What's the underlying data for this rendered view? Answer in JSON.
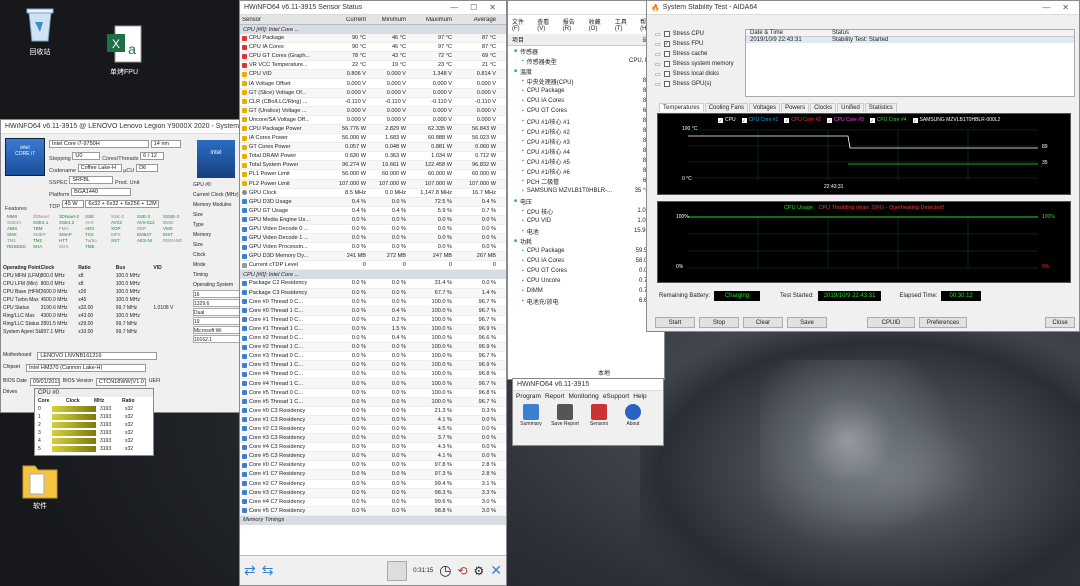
{
  "desktop": {
    "icons": [
      {
        "label": "回收站"
      },
      {
        "label": "单烤FPU"
      },
      {
        "label": "软件"
      }
    ]
  },
  "hw_sensors": {
    "title": "HWiNFO64 v6.11-3915 Sensor Status",
    "headers": [
      "Sensor",
      "Current",
      "Minimum",
      "Maximum",
      "Average"
    ],
    "groups": [
      {
        "name": "CPU [#0]: Intel Core ...",
        "rows": [
          [
            "CPU Package",
            "90 °C",
            "46 °C",
            "97 °C",
            "87 °C"
          ],
          [
            "CPU IA Cores",
            "90 °C",
            "46 °C",
            "97 °C",
            "87 °C"
          ],
          [
            "CPU GT Cores (Graph...",
            "78 °C",
            "43 °C",
            "72 °C",
            "69 °C"
          ],
          [
            "VR VCC Temperature...",
            "22 °C",
            "19 °C",
            "23 °C",
            "21 °C"
          ],
          [
            "CPU VID",
            "0.806 V",
            "0.000 V",
            "1.348 V",
            "0.814 V"
          ],
          [
            "IA Voltage Offset",
            "0.000 V",
            "0.000 V",
            "0.000 V",
            "0.000 V"
          ],
          [
            "GT (Slice) Voltage Of...",
            "0.000 V",
            "0.000 V",
            "0.000 V",
            "0.000 V"
          ],
          [
            "CLR (CBo/LLC/Ring) ...",
            "-0.110 V",
            "-0.110 V",
            "-0.110 V",
            "-0.110 V"
          ],
          [
            "GT (Unslice) Voltage ...",
            "0.000 V",
            "0.000 V",
            "0.000 V",
            "0.000 V"
          ],
          [
            "Uncore/SA Voltage Off...",
            "0.000 V",
            "0.000 V",
            "0.000 V",
            "0.000 V"
          ],
          [
            "CPU Package Power",
            "56.776 W",
            "2.829 W",
            "62.335 W",
            "56.843 W"
          ],
          [
            "IA Cores Power",
            "56.000 W",
            "1.683 W",
            "60.888 W",
            "56.023 W"
          ],
          [
            "GT Cores Power",
            "0.057 W",
            "0.048 W",
            "0.881 W",
            "0.060 W"
          ],
          [
            "Total DRAM Power",
            "0.630 W",
            "0.363 W",
            "1.034 W",
            "0.712 W"
          ],
          [
            "Total System Power",
            "96.274 W",
            "19.661 W",
            "122.458 W",
            "96.832 W"
          ],
          [
            "PL1 Power Limit",
            "56.000 W",
            "60.000 W",
            "60.000 W",
            "60.000 W"
          ],
          [
            "PL2 Power Limit",
            "107.000 W",
            "107.000 W",
            "107.000 W",
            "107.000 W"
          ],
          [
            "GPU Clock",
            "8.5 MHz",
            "0.0 MHz",
            "1,147.8 MHz",
            "16.7 MHz"
          ],
          [
            "GPU D3D Usage",
            "0.4 %",
            "0.0 %",
            "72.5 %",
            "0.4 %"
          ],
          [
            "GPU GT Usage",
            "0.4 %",
            "0.4 %",
            "5.9 %",
            "0.7 %"
          ],
          [
            "GPU Media Engine Us...",
            "0.0 %",
            "0.0 %",
            "0.0 %",
            "0.0 %"
          ],
          [
            "GPU Video Decode 0 ...",
            "0.0 %",
            "0.0 %",
            "0.0 %",
            "0.0 %"
          ],
          [
            "GPU Video Decode 1 ...",
            "0.0 %",
            "0.0 %",
            "0.0 %",
            "0.0 %"
          ],
          [
            "GPU Video Processin...",
            "0.0 %",
            "0.0 %",
            "0.0 %",
            "0.0 %"
          ],
          [
            "GPU D3D Memory Dy...",
            "241 MB",
            "272 MB",
            "247 MB",
            "267 MB"
          ],
          [
            "Current cTDP Level",
            "0",
            "0",
            "0",
            "0"
          ]
        ]
      },
      {
        "name": "CPU [#0]: Intel Core ...",
        "rows": [
          [
            "Package C2 Residency",
            "0.0 %",
            "0.0 %",
            "31.4 %",
            "0.0 %"
          ],
          [
            "Package C3 Residency",
            "0.0 %",
            "0.0 %",
            "67.7 %",
            "1.4 %"
          ],
          [
            "Core #0 Thread 0 C...",
            "0.0 %",
            "0.0 %",
            "100.0 %",
            "96.7 %"
          ],
          [
            "Core #0 Thread 1 C...",
            "0.0 %",
            "0.4 %",
            "100.0 %",
            "96.7 %"
          ],
          [
            "Core #1 Thread 0 C...",
            "0.0 %",
            "0.2 %",
            "100.0 %",
            "96.7 %"
          ],
          [
            "Core #1 Thread 1 C...",
            "0.0 %",
            "1.5 %",
            "100.0 %",
            "96.9 %"
          ],
          [
            "Core #2 Thread 0 C...",
            "0.0 %",
            "0.4 %",
            "100.0 %",
            "96.6 %"
          ],
          [
            "Core #2 Thread 1 C...",
            "0.0 %",
            "0.0 %",
            "100.0 %",
            "96.9 %"
          ],
          [
            "Core #3 Thread 0 C...",
            "0.0 %",
            "0.0 %",
            "100.0 %",
            "96.7 %"
          ],
          [
            "Core #3 Thread 1 C...",
            "0.0 %",
            "0.0 %",
            "100.0 %",
            "96.9 %"
          ],
          [
            "Core #4 Thread 0 C...",
            "0.0 %",
            "0.0 %",
            "100.0 %",
            "96.8 %"
          ],
          [
            "Core #4 Thread 1 C...",
            "0.0 %",
            "0.0 %",
            "100.0 %",
            "96.7 %"
          ],
          [
            "Core #5 Thread 0 C...",
            "0.0 %",
            "0.0 %",
            "100.0 %",
            "96.8 %"
          ],
          [
            "Core #5 Thread 1 C...",
            "0.0 %",
            "0.0 %",
            "100.0 %",
            "96.7 %"
          ],
          [
            "Core #0 C3 Residency",
            "0.0 %",
            "0.0 %",
            "21.3 %",
            "0.3 %"
          ],
          [
            "Core #1 C3 Residency",
            "0.0 %",
            "0.0 %",
            "4.1 %",
            "0.0 %"
          ],
          [
            "Core #2 C3 Residency",
            "0.0 %",
            "0.0 %",
            "4.5 %",
            "0.0 %"
          ],
          [
            "Core #3 C3 Residency",
            "0.0 %",
            "0.0 %",
            "3.7 %",
            "0.0 %"
          ],
          [
            "Core #4 C3 Residency",
            "0.0 %",
            "0.0 %",
            "4.3 %",
            "0.0 %"
          ],
          [
            "Core #5 C3 Residency",
            "0.0 %",
            "0.0 %",
            "4.1 %",
            "0.0 %"
          ],
          [
            "Core #0 C7 Residency",
            "0.0 %",
            "0.0 %",
            "97.8 %",
            "2.8 %"
          ],
          [
            "Core #1 C7 Residency",
            "0.0 %",
            "0.0 %",
            "97.3 %",
            "2.8 %"
          ],
          [
            "Core #2 C7 Residency",
            "0.0 %",
            "0.0 %",
            "99.4 %",
            "3.1 %"
          ],
          [
            "Core #3 C7 Residency",
            "0.0 %",
            "0.0 %",
            "98.3 %",
            "3.3 %"
          ],
          [
            "Core #4 C7 Residency",
            "0.0 %",
            "0.0 %",
            "99.6 %",
            "3.0 %"
          ],
          [
            "Core #5 C7 Residency",
            "0.0 %",
            "0.0 %",
            "98.8 %",
            "3.0 %"
          ]
        ]
      }
    ],
    "footer_group": "Memory Timings",
    "timer": "0:31:15"
  },
  "hw_summary": {
    "title": "HWiNFO64 v6.11-3915 @ LENOVO Lenovo Legion Y9000X 2020 - System Summary",
    "cpu_name": "Intel Core i7-9750H",
    "nm": "14 nm",
    "stepping_label": "Stepping",
    "stepping": "U0",
    "cores_label": "Cores/Threads",
    "cores": "6 / 12",
    "codename_label": "Codename",
    "codename": "Coffee Lake-H",
    "ucu_label": "µCU",
    "ucu": "D6",
    "sspec_label": "SSPEC",
    "sspec": "SRFBL",
    "prod_label": "Prod. Unit",
    "platform_label": "Platform",
    "platform": "BGA1440",
    "tdp_label": "TDP",
    "tdp": "45 W",
    "cache": "6x32 + 6x32 + 6x256 + 12M",
    "features_label": "Features",
    "features": [
      "MMX",
      "3DNow!",
      "3DNow!-2",
      "SSE",
      "SSE-2",
      "SSE-3",
      "SSSE-3",
      "SSE4A",
      "SSE4.1",
      "SSE4.2",
      "AVX",
      "AVX2",
      "AVX-512",
      "BMI2",
      "ABM",
      "TBM",
      "FMA",
      "ADX",
      "XOP",
      "DEP",
      "VMX",
      "SMX",
      "SMEP",
      "SMAP",
      "TSX",
      "MPX",
      "EM64T",
      "EIST",
      "TM1",
      "TM2",
      "HTT",
      "Turbo",
      "SST",
      "AES-NI",
      "RDRAND",
      "RDSEED",
      "SHA",
      "SGX",
      "TME"
    ],
    "op_headers": [
      "Operating Point",
      "Clock",
      "Ratio",
      "Bus",
      "VID"
    ],
    "op_rows": [
      [
        "CPU MFM (LFM)",
        "800.0 MHz",
        "x8",
        "100.0 MHz",
        ""
      ],
      [
        "CPU LFM (Min)",
        "800.0 MHz",
        "x8",
        "100.0 MHz",
        ""
      ],
      [
        "CPU Base (HFM)",
        "2600.0 MHz",
        "x26",
        "100.0 MHz",
        ""
      ],
      [
        "CPU Turbo Max",
        "4500.0 MHz",
        "x45",
        "100.0 MHz",
        ""
      ],
      [
        "CPU Status",
        "3190.6 MHz",
        "x32.00",
        "99.7 MHz",
        "1.0108 V"
      ],
      [
        "Ring/LLC Max",
        "4300.0 MHz",
        "x43.00",
        "100.0 MHz",
        ""
      ],
      [
        "Ring/LLC Status",
        "2891.5 MHz",
        "x29.00",
        "99.7 MHz",
        ""
      ],
      [
        "System Agent Status",
        "997.1 MHz",
        "x10.00",
        "99.7 MHz",
        ""
      ]
    ],
    "mb_label": "Motherboard",
    "mb": "LENOVO LNVNB161216",
    "chipset_label": "Chipset",
    "chipset": "Intel HM370 (Cannon Lake-H)",
    "bios_label": "BIOS Date",
    "bios_date": "09/01/2019",
    "bios_ver_label": "BIOS Version",
    "bios_ver": "CTCN18WW(V1.07)",
    "uefi": "UEFI",
    "drives_label": "Drives",
    "gpu_label": "GPU #0",
    "right_labels": [
      "Current Clock (MHz)",
      "Memory Modules",
      "Size",
      "Type",
      "Memory",
      "Size",
      "Clock",
      "Mode",
      "Timing",
      "Operating System"
    ],
    "right_vals": [
      "16",
      "1329.6",
      "Dual",
      "19",
      "Microsoft Wi",
      "10162.1"
    ]
  },
  "cpu_clocks": {
    "title": "CPU #0",
    "headers": [
      "Core",
      "Clock",
      "MHz",
      "Ratio"
    ],
    "rows": [
      [
        "0",
        "",
        "3193",
        "x32"
      ],
      [
        "1",
        "",
        "3193",
        "x32"
      ],
      [
        "2",
        "",
        "3193",
        "x32"
      ],
      [
        "3",
        "",
        "3193",
        "x32"
      ],
      [
        "4",
        "",
        "3193",
        "x32"
      ],
      [
        "5",
        "",
        "3193",
        "x32"
      ]
    ]
  },
  "aida_tree": {
    "menu": [
      "文件(F)",
      "查看(V)",
      "报告(R)",
      "收藏(O)",
      "工具(T)",
      "帮助(H)"
    ],
    "col_left": "项目",
    "col_right": "当前值",
    "items": [
      {
        "t": "传感器",
        "v": ""
      },
      {
        "t": "传感器类型",
        "v": "CPU, HDD"
      },
      {
        "t": "温度",
        "v": ""
      },
      {
        "t": "中央处理器(CPU)",
        "v": "89 °C"
      },
      {
        "t": "CPU Package",
        "v": "89 °C"
      },
      {
        "t": "CPU IA Cores",
        "v": "89 °C"
      },
      {
        "t": "CPU GT Cores",
        "v": "69 °C"
      },
      {
        "t": "CPU #1/核心 #1",
        "v": "89 °C"
      },
      {
        "t": "CPU #1/核心 #2",
        "v": "85 °C"
      },
      {
        "t": "CPU #1/核心 #3",
        "v": "89 °C"
      },
      {
        "t": "CPU #1/核心 #4",
        "v": "84 °C"
      },
      {
        "t": "CPU #1/核心 #5",
        "v": "85 °C"
      },
      {
        "t": "CPU #1/核心 #6",
        "v": "83 °C"
      },
      {
        "t": "PCH 二极管",
        "v": "65 °C"
      },
      {
        "t": "SAMSUNG MZVLB1T0HBLR-...",
        "v": "35 °C / 3"
      },
      {
        "t": "电压",
        "v": ""
      },
      {
        "t": "CPU 核心",
        "v": "1.018 V"
      },
      {
        "t": "CPU VID",
        "v": "1.018 V"
      },
      {
        "t": "电池",
        "v": "15.964 V"
      },
      {
        "t": "功耗",
        "v": ""
      },
      {
        "t": "CPU Package",
        "v": "59.58 W"
      },
      {
        "t": "CPU IA Cores",
        "v": "58.08 W"
      },
      {
        "t": "CPU GT Cores",
        "v": "0.09 W"
      },
      {
        "t": "CPU Uncore",
        "v": "0.71 W"
      },
      {
        "t": "DIMM",
        "v": "0.72 W"
      },
      {
        "t": "电池充/放电",
        "v": "6.65 W"
      }
    ],
    "footer": "本地"
  },
  "stability": {
    "title": "System Stability Test - AIDA64",
    "options": [
      {
        "l": "Stress CPU",
        "c": false
      },
      {
        "l": "Stress FPU",
        "c": true
      },
      {
        "l": "Stress cache",
        "c": false
      },
      {
        "l": "Stress system memory",
        "c": false
      },
      {
        "l": "Stress local disks",
        "c": false
      },
      {
        "l": "Stress GPU(s)",
        "c": false
      }
    ],
    "log_headers": [
      "Date & Time",
      "Status"
    ],
    "log": [
      {
        "d": "2019/10/9 22:43:31",
        "s": "Stability Test: Started"
      }
    ],
    "tabs": [
      "Temperatures",
      "Cooling Fans",
      "Voltages",
      "Powers",
      "Clocks",
      "Unified",
      "Statistics"
    ],
    "legend1": [
      "CPU",
      "CPU Core #1",
      "CPU Core #2",
      "CPU Core #3",
      "CPU Core #4",
      "SAMSUNG MZVLB1T0HBLR-000L2"
    ],
    "g1_top": "100 °C",
    "g1_bot": "0 °C",
    "g1_time": "22:43:31",
    "g1_r1": "89",
    "g1_r2": "35",
    "g2_title": "CPU Usage",
    "g2_throttle": "CPU Throttling (max: 29%) - Overheating Detected!",
    "g2_top": "100%",
    "g2_bot": "0%",
    "g2_rtop": "100%",
    "g2_rbot": "0%",
    "battery_label": "Remaining Battery:",
    "battery": "Charging",
    "started_label": "Test Started:",
    "started": "2019/10/9 22:43:31",
    "elapsed_label": "Elapsed Time:",
    "elapsed": "00:30:12",
    "buttons": [
      "Start",
      "Stop",
      "Clear",
      "Save",
      "CPUID",
      "Preferences"
    ],
    "close": "Close"
  },
  "hwinfo_small": {
    "title": "HWiNFO64 v6.11-3915",
    "menu": [
      "Program",
      "Report",
      "Monitoring",
      "eSupport",
      "Help"
    ],
    "tools": [
      "Summary",
      "Save Report",
      "Sensors",
      "About"
    ]
  },
  "colors": {
    "graph_green": "#00ff66",
    "legend_cpu": "#ffffff",
    "core1": "#00aaff",
    "core2": "#ff3333",
    "core3": "#ff44ff",
    "core4": "#22dd22"
  }
}
